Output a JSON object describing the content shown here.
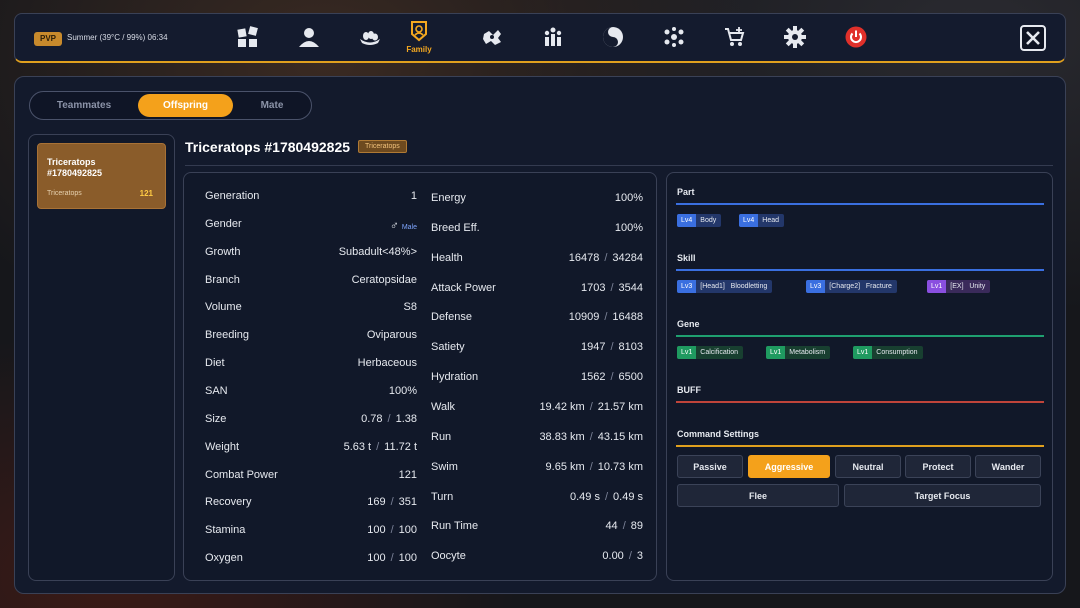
{
  "header": {
    "mode_badge": "PVP",
    "weather": "Summer (39°C / 99%) 06:34",
    "nav": [
      {
        "id": "inventory",
        "icon": "grid-blocks-icon",
        "label": ""
      },
      {
        "id": "profile",
        "icon": "person-icon",
        "label": ""
      },
      {
        "id": "nest",
        "icon": "nest-icon",
        "label": ""
      },
      {
        "id": "family",
        "icon": "family-crest-icon",
        "label": "Family",
        "active": true
      },
      {
        "id": "map",
        "icon": "puzzle-map-icon",
        "label": ""
      },
      {
        "id": "group",
        "icon": "group-icon",
        "label": ""
      },
      {
        "id": "daynight",
        "icon": "yin-yang-icon",
        "label": ""
      },
      {
        "id": "social",
        "icon": "network-icon",
        "label": ""
      },
      {
        "id": "shop",
        "icon": "shop-cart-icon",
        "label": ""
      },
      {
        "id": "settings",
        "icon": "gear-icon",
        "label": ""
      },
      {
        "id": "power",
        "icon": "power-icon",
        "label": ""
      }
    ],
    "accent_color": "#e0a01e",
    "power_color": "#e0302a"
  },
  "tabs": [
    {
      "label": "Teammates",
      "active": false
    },
    {
      "label": "Offspring",
      "active": true
    },
    {
      "label": "Mate",
      "active": false
    }
  ],
  "offspring_list": [
    {
      "name": "Triceratops #1780492825",
      "species": "Triceratops",
      "level": "121"
    }
  ],
  "detail": {
    "title": "Triceratops #1780492825",
    "species_badge": "Triceratops",
    "left_stats": [
      {
        "label": "Generation",
        "value": "1"
      },
      {
        "label": "Gender",
        "value": "Male",
        "symbol": "♂"
      },
      {
        "label": "Growth",
        "value": "Subadult<48%>"
      },
      {
        "label": "Branch",
        "value": "Ceratopsidae"
      },
      {
        "label": "Volume",
        "value": "S8"
      },
      {
        "label": "Breeding",
        "value": "Oviparous"
      },
      {
        "label": "Diet",
        "value": "Herbaceous"
      },
      {
        "label": "SAN",
        "value": "100%"
      },
      {
        "label": "Size",
        "value": "0.78",
        "max": "1.38"
      },
      {
        "label": "Weight",
        "value": "5.63 t",
        "max": "11.72 t"
      },
      {
        "label": "Combat Power",
        "value": "121"
      },
      {
        "label": "Recovery",
        "value": "169",
        "max": "351"
      },
      {
        "label": "Stamina",
        "value": "100",
        "max": "100"
      },
      {
        "label": "Oxygen",
        "value": "100",
        "max": "100"
      }
    ],
    "right_stats": [
      {
        "label": "Energy",
        "value": "100%"
      },
      {
        "label": "Breed Eff.",
        "value": "100%"
      },
      {
        "label": "Health",
        "value": "16478",
        "max": "34284"
      },
      {
        "label": "Attack Power",
        "value": "1703",
        "max": "3544"
      },
      {
        "label": "Defense",
        "value": "10909",
        "max": "16488"
      },
      {
        "label": "Satiety",
        "value": "1947",
        "max": "8103"
      },
      {
        "label": "Hydration",
        "value": "1562",
        "max": "6500"
      },
      {
        "label": "Walk",
        "value": "19.42 km",
        "max": "21.57 km"
      },
      {
        "label": "Run",
        "value": "38.83 km",
        "max": "43.15 km"
      },
      {
        "label": "Swim",
        "value": "9.65 km",
        "max": "10.73 km"
      },
      {
        "label": "Turn",
        "value": "0.49 s",
        "max": "0.49 s"
      },
      {
        "label": "Run Time",
        "value": "44",
        "max": "89"
      },
      {
        "label": "Oocyte",
        "value": "0.00",
        "max": "3"
      }
    ]
  },
  "info": {
    "part": {
      "title": "Part",
      "line_color": "#3a6fe0",
      "chips": [
        {
          "level": "Lv4",
          "name": "Body",
          "color": "blue"
        },
        {
          "level": "Lv4",
          "name": "Head",
          "color": "blue"
        }
      ]
    },
    "skill": {
      "title": "Skill",
      "line_color": "#3a6fe0",
      "chips": [
        {
          "level": "Lv3",
          "name": "[Head1]   Bloodletting",
          "color": "blue"
        },
        {
          "level": "Lv3",
          "name": "[Charge2]   Fracture",
          "color": "blue"
        },
        {
          "level": "Lv1",
          "name": "[EX]   Unity",
          "color": "purple"
        }
      ]
    },
    "gene": {
      "title": "Gene",
      "line_color": "#1fa070",
      "chips": [
        {
          "level": "Lv1",
          "name": "Calcification",
          "color": "green"
        },
        {
          "level": "Lv1",
          "name": "Metabolism",
          "color": "green"
        },
        {
          "level": "Lv1",
          "name": "Consumption",
          "color": "green"
        }
      ]
    },
    "buff": {
      "title": "BUFF",
      "line_color": "#c0443a"
    },
    "command": {
      "title": "Command Settings",
      "line_color": "#e0a01e",
      "buttons": [
        {
          "label": "Passive",
          "active": false
        },
        {
          "label": "Aggressive",
          "active": true
        },
        {
          "label": "Neutral",
          "active": false
        },
        {
          "label": "Protect",
          "active": false
        },
        {
          "label": "Wander",
          "active": false
        },
        {
          "label": "Flee",
          "active": false
        },
        {
          "label": "Target Focus",
          "active": false
        }
      ]
    }
  }
}
